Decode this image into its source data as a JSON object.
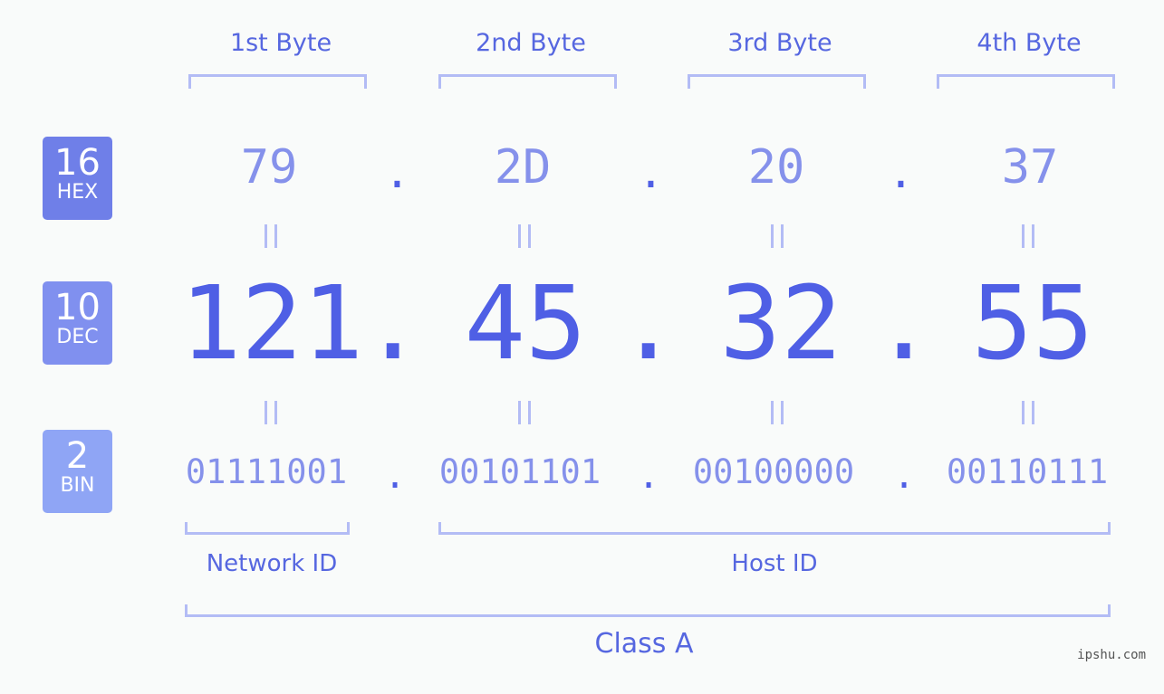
{
  "badges": [
    {
      "num": "16",
      "label": "HEX",
      "color": "#6f7fe8"
    },
    {
      "num": "10",
      "label": "DEC",
      "color": "#8090ef"
    },
    {
      "num": "2",
      "label": "BIN",
      "color": "#8fa5f5"
    }
  ],
  "bytes": [
    {
      "header": "1st Byte",
      "hex": "79",
      "dec": "121",
      "bin": "01111001"
    },
    {
      "header": "2nd Byte",
      "hex": "2D",
      "dec": "45",
      "bin": "00101101"
    },
    {
      "header": "3rd Byte",
      "hex": "20",
      "dec": "32",
      "bin": "00100000"
    },
    {
      "header": "4th Byte",
      "hex": "37",
      "dec": "55",
      "bin": "00110111"
    }
  ],
  "separator": ".",
  "network_label": "Network ID",
  "host_label": "Host ID",
  "class_label": "Class A",
  "watermark": "ipshu.com"
}
